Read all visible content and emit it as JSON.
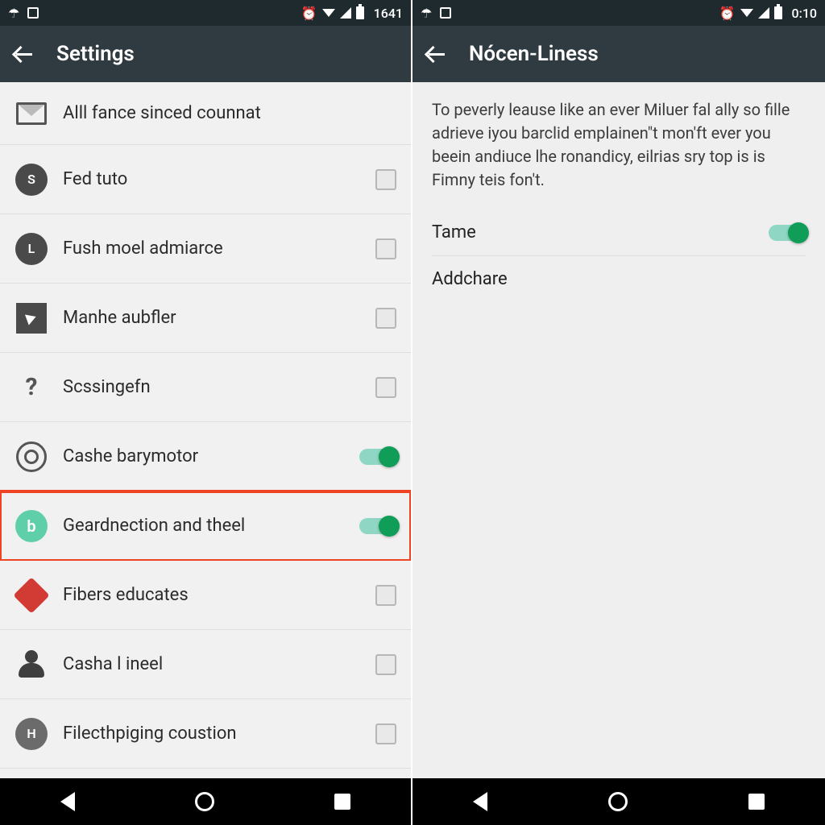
{
  "left": {
    "status_time": "1641",
    "title": "Settings",
    "items": [
      {
        "label": "Alll fance sinced counnat",
        "icon": "mail",
        "control": "none"
      },
      {
        "label": "Fed tuto",
        "icon": "circle-s",
        "control": "checkbox",
        "checked": false
      },
      {
        "label": "Fush moel admiarce",
        "icon": "circle-l",
        "control": "checkbox",
        "checked": false
      },
      {
        "label": "Manhe aubfler",
        "icon": "send",
        "control": "checkbox",
        "checked": false
      },
      {
        "label": "Scssingefn",
        "icon": "question",
        "control": "checkbox",
        "checked": false
      },
      {
        "label": "Cashe barymotor",
        "icon": "target",
        "control": "switch",
        "checked": true
      },
      {
        "label": "Geardnection and theel",
        "icon": "circle-b",
        "control": "switch",
        "checked": true,
        "highlight": true
      },
      {
        "label": "Fibers educates",
        "icon": "diamond",
        "control": "checkbox",
        "checked": false
      },
      {
        "label": "Casha l ineel",
        "icon": "person",
        "control": "checkbox",
        "checked": false
      },
      {
        "label": "Filecthpiging coustion",
        "icon": "circle-h",
        "control": "checkbox",
        "checked": false
      }
    ]
  },
  "right": {
    "status_time": "0:10",
    "title": "Nócen-Liness",
    "description": "To peverly leause like an ever Miluer fal ally so fille adrieve iyou barclid emplainen\"t mon'ft ever you beein andiuce lhe ronandicy, eilrias sry top is is Fimny teis fon't.",
    "rows": [
      {
        "label": "Tame",
        "control": "switch",
        "checked": true
      },
      {
        "label": "Addchare",
        "control": "none"
      }
    ]
  },
  "colors": {
    "accent": "#0f9d58",
    "appbar": "#2f3b40",
    "highlight": "#ef4423"
  }
}
